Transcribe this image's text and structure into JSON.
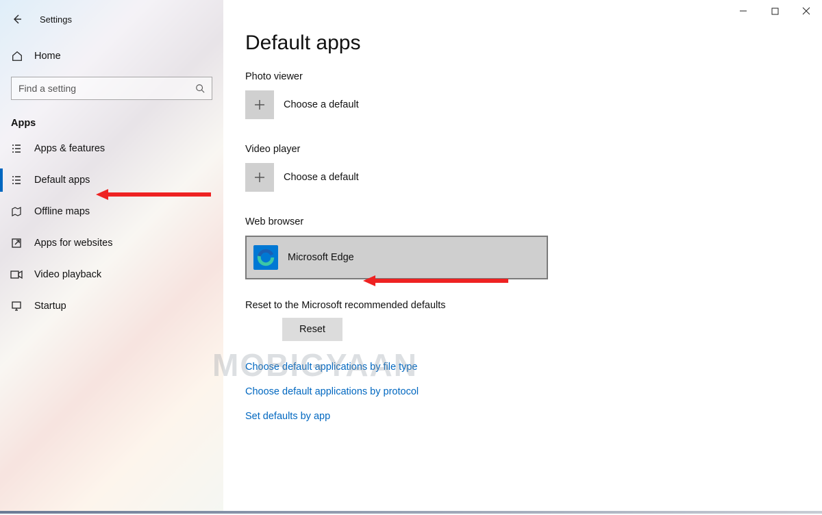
{
  "window": {
    "title": "Settings"
  },
  "sidebar": {
    "home_label": "Home",
    "search_placeholder": "Find a setting",
    "group_label": "Apps",
    "items": [
      {
        "label": "Apps & features"
      },
      {
        "label": "Default apps"
      },
      {
        "label": "Offline maps"
      },
      {
        "label": "Apps for websites"
      },
      {
        "label": "Video playback"
      },
      {
        "label": "Startup"
      }
    ]
  },
  "main": {
    "page_title": "Default apps",
    "sections": {
      "photo_viewer": {
        "label": "Photo viewer",
        "choose": "Choose a default"
      },
      "video_player": {
        "label": "Video player",
        "choose": "Choose a default"
      },
      "web_browser": {
        "label": "Web browser",
        "app_name": "Microsoft Edge"
      }
    },
    "reset": {
      "label": "Reset to the Microsoft recommended defaults",
      "button": "Reset"
    },
    "links": [
      "Choose default applications by file type",
      "Choose default applications by protocol",
      "Set defaults by app"
    ]
  },
  "watermark": "MOBIGYAAN"
}
